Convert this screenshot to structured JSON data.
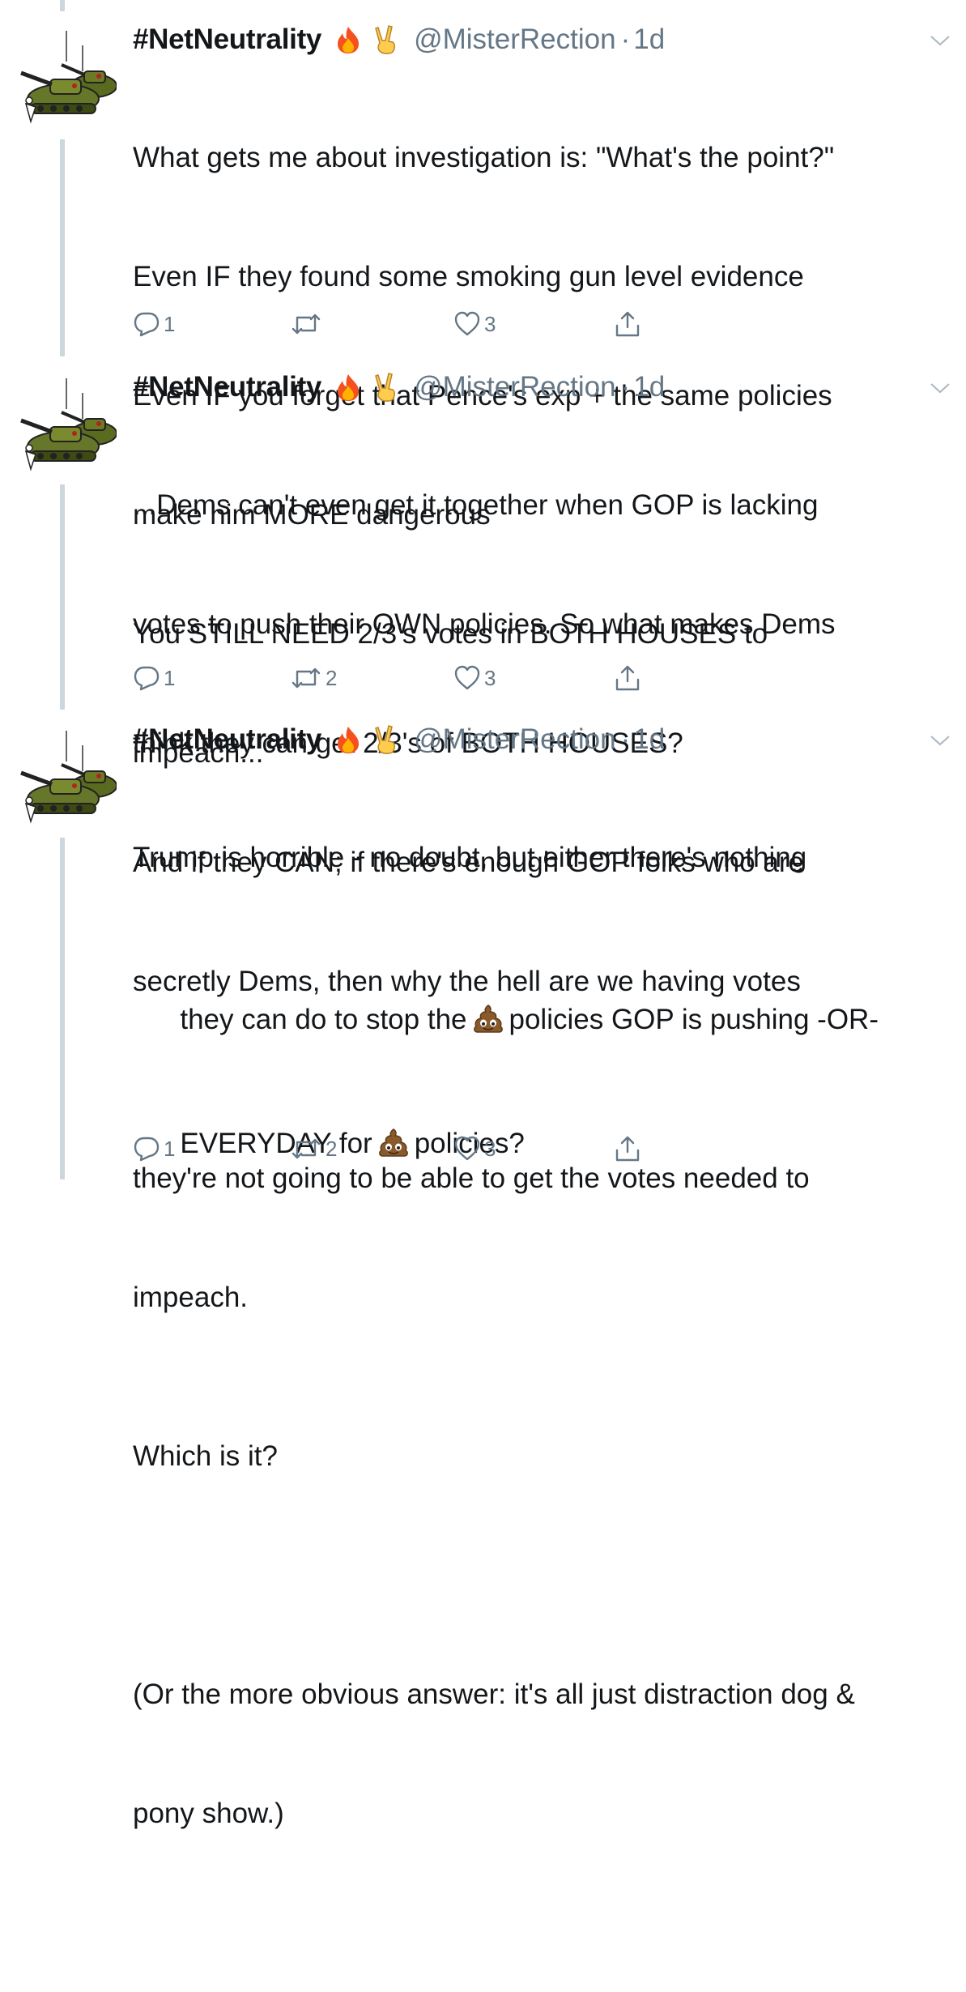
{
  "tweets": [
    {
      "display_name": "#NetNeutrality",
      "handle": "@MisterRection",
      "dot": "·",
      "time": "1d",
      "lines": [
        "What gets me about investigation is: \"What's the point?\"",
        "Even IF they found some smoking gun level evidence",
        "Even IF you forget that Pence's exp + the same policies",
        "make him MORE dangerous",
        "You STILL NEED 2/3's votes in BOTH HOUSES to",
        "impeach..."
      ],
      "actions": {
        "reply": "1",
        "retweet": "",
        "like": "3"
      }
    },
    {
      "display_name": "#NetNeutrality",
      "handle": "@MisterRection",
      "dot": "·",
      "time": "1d",
      "lines": [
        "...Dems can't even get it together when GOP is lacking",
        "votes to push their OWN policies. So what makes Dems",
        "think they can get 2/3's of BOTH HOUSES?",
        "And if they CAN; if there's enough GOP folks who are",
        "secretly Dems, then why the hell are we having votes"
      ],
      "line_with_emoji": {
        "before": "EVERYDAY for",
        "after": "policies?"
      },
      "actions": {
        "reply": "1",
        "retweet": "2",
        "like": "3"
      }
    },
    {
      "display_name": "#NetNeutrality",
      "handle": "@MisterRection",
      "dot": "·",
      "time": "1d",
      "line1": "Trump is horrible - no doubt, but either there's nothing",
      "line_with_emoji": {
        "before": "they can do to stop the",
        "after": "policies GOP is pushing -OR-"
      },
      "lines_after": [
        "they're not going to be able to get the votes needed to",
        "impeach."
      ],
      "para2": "Which is it?",
      "para3": [
        "(Or the more obvious answer: it's all just distraction dog &",
        "pony show.)"
      ],
      "actions": {
        "reply": "1",
        "retweet": "2",
        "like": "3"
      }
    }
  ],
  "icons": {
    "avatar": "tank-avatar-icon",
    "fire": "fire-emoji-icon",
    "victory": "victory-hand-emoji-icon",
    "poo": "pile-of-poo-emoji-icon",
    "reply": "reply-icon",
    "retweet": "retweet-icon",
    "like": "heart-icon",
    "share": "share-icon",
    "caret": "chevron-down-icon"
  },
  "colors": {
    "text": "#14171a",
    "secondary": "#657786",
    "thread_line": "#ccd6dd"
  }
}
